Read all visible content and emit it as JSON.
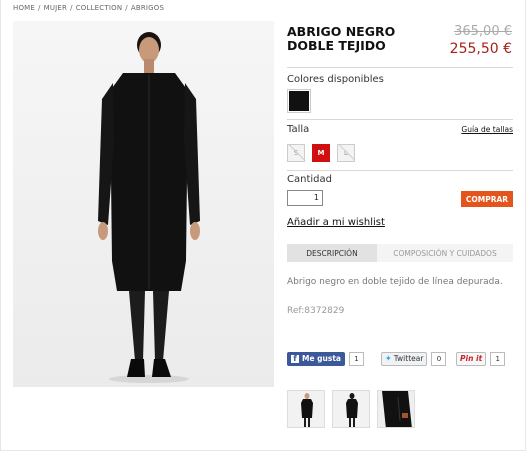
{
  "breadcrumb": [
    "HOME",
    "/",
    "MUJER",
    "/",
    "COLLECTION",
    "/",
    "ABRIGOS"
  ],
  "product": {
    "title": "ABRIGO NEGRO DOBLE TEJIDO",
    "price_old": "365,00 €",
    "price_new": "255,50 €",
    "colors_label": "Colores disponibles",
    "size_label": "Talla",
    "size_guide": "Guía de tallas",
    "sizes": [
      "S",
      "M",
      "L"
    ],
    "selected_size": "M",
    "quantity_label": "Cantidad",
    "quantity": "1",
    "buy_label": "COMPRAR",
    "wishlist_label": "Añadir a mi wishlist",
    "tabs": [
      "DESCRIPCIÓN",
      "COMPOSICIÓN Y CUIDADOS"
    ],
    "description": "Abrigo negro en doble tejido de línea depurada.",
    "ref": "Ref:8372829"
  },
  "colors": {
    "accent": "#a4221a",
    "buy": "#e4541d",
    "swatch": "#111111",
    "size_active": "#d01010"
  },
  "social": {
    "facebook_label": "Me gusta",
    "facebook_count": "1",
    "twitter_label": "Twittear",
    "twitter_count": "0",
    "pinterest_label": "Pin it",
    "pinterest_count": "1"
  },
  "icons": {
    "facebook": "facebook-icon",
    "twitter": "twitter-bird-icon"
  }
}
